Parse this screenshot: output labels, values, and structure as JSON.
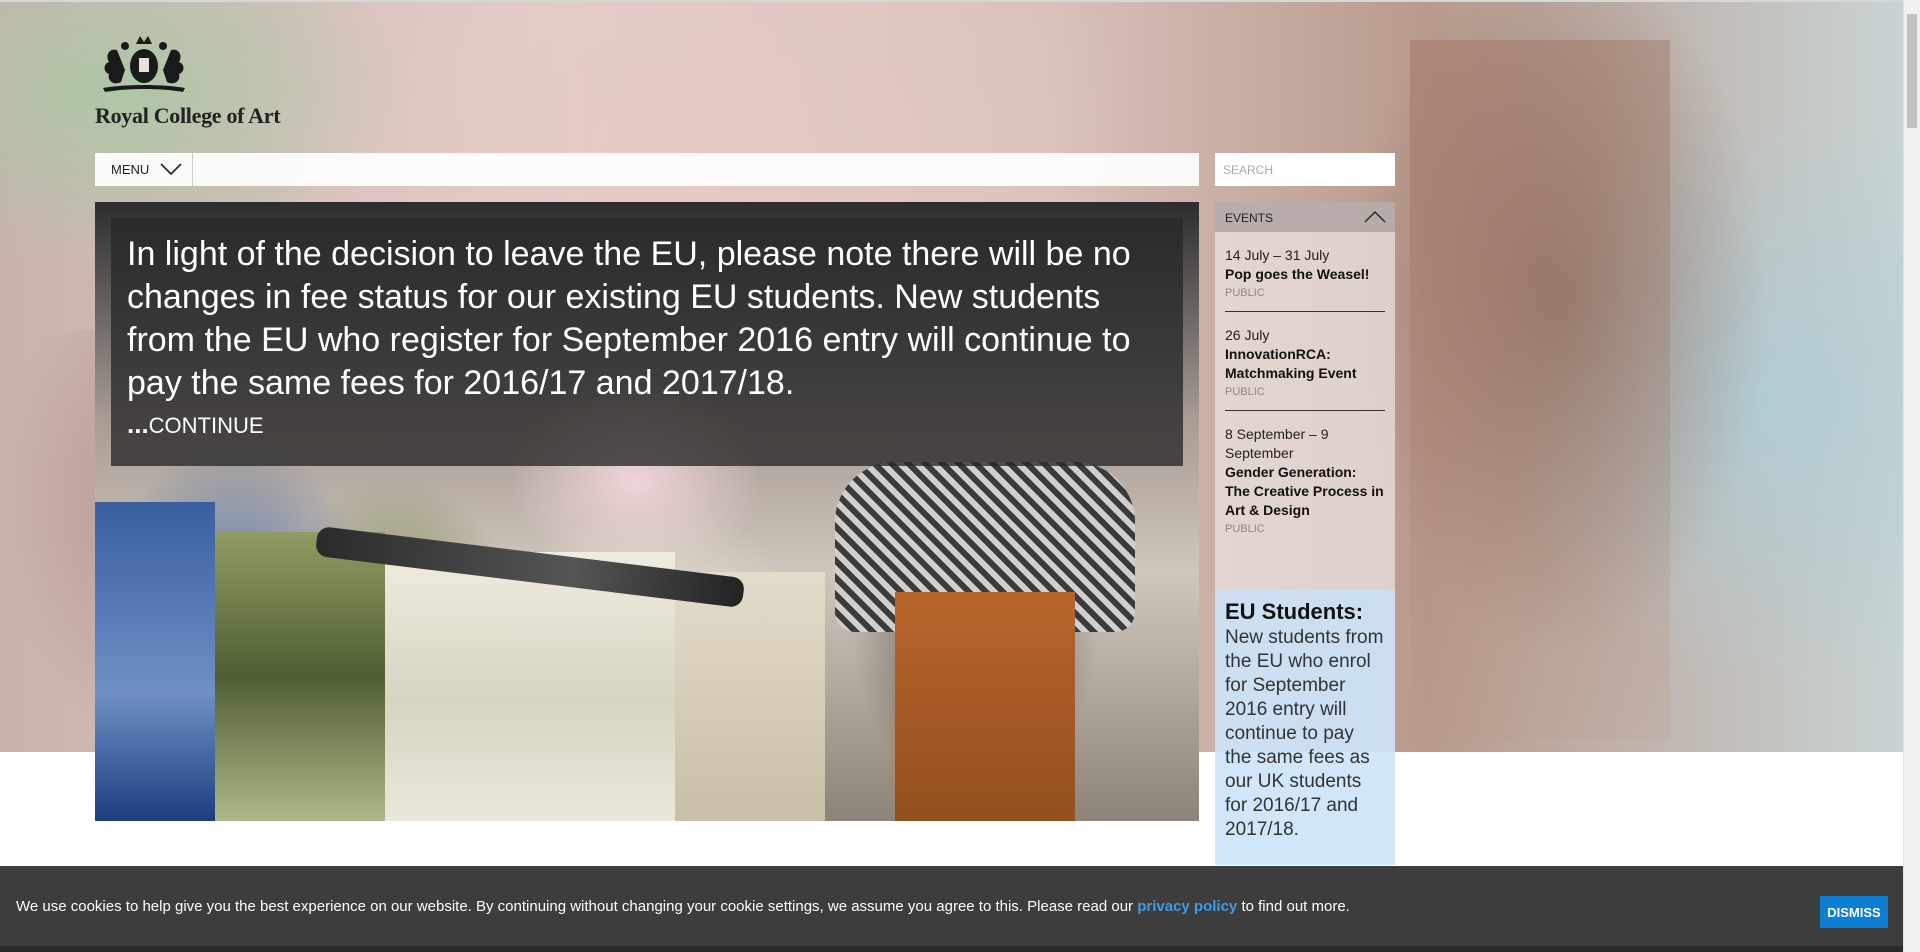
{
  "site": {
    "name": "Royal College of Art"
  },
  "nav": {
    "menu_label": "MENU",
    "search_placeholder": "SEARCH"
  },
  "hero": {
    "notice": "In light of the decision to leave the EU, please note there will be no changes in fee status for our existing EU students. New students from the EU who register for September 2016 entry will continue to pay the same fees for 2016/17 and 2017/18.",
    "continue_dots": "...",
    "continue_label": "CONTINUE"
  },
  "events": {
    "title": "EVENTS",
    "items": [
      {
        "date": "14 July – 31 July",
        "title": "Pop goes the Weasel!",
        "tag": "PUBLIC"
      },
      {
        "date": "26 July",
        "title": "InnovationRCA: Matchmaking Event",
        "tag": "PUBLIC"
      },
      {
        "date": "8 September – 9 September",
        "title": "Gender Generation: The Creative Process in Art & Design",
        "tag": "PUBLIC"
      }
    ]
  },
  "eu_box": {
    "title": "EU Students:",
    "body": "New students from the EU who enrol for September 2016 entry will continue to pay the same fees as our UK students for 2016/17 and 2017/18."
  },
  "cookie": {
    "text_before": "We use cookies to help give you the best experience on our website. By continuing without changing your cookie settings, we assume you agree to this. Please read our ",
    "link_label": "privacy policy",
    "text_after": " to find out more.",
    "dismiss_label": "DISMISS"
  },
  "colors": {
    "accent": "#0c7fd2",
    "link": "#3d9be9",
    "cookie_bg": "#3d3d3d",
    "eu_bg": "#cde4f8"
  },
  "icons": {
    "menu": "chevron-down-icon",
    "events": "chevron-up-icon",
    "logo": "royal-crest-icon"
  }
}
